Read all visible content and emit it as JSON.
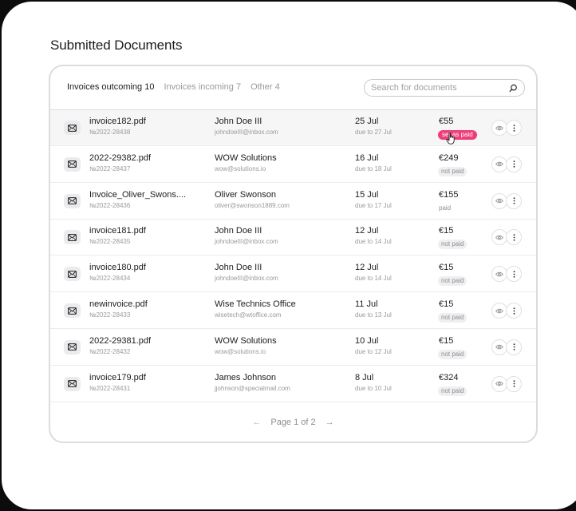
{
  "page_title": "Submitted Documents",
  "tabs": [
    {
      "label": "Invoices outcoming 10",
      "active": true
    },
    {
      "label": "Invoices incoming 7",
      "active": false
    },
    {
      "label": "Other 4",
      "active": false
    }
  ],
  "search": {
    "placeholder": "Search for documents"
  },
  "rows": [
    {
      "file": "invoice182.pdf",
      "number": "№2022-28438",
      "client": "John Doe III",
      "email": "johndoeIII@inbox.com",
      "date": "25 Jul",
      "due": "due to 27 Jul",
      "amount": "€55",
      "status": "set as paid"
    },
    {
      "file": "2022-29382.pdf",
      "number": "№2022-28437",
      "client": "WOW Solutions",
      "email": "wow@solutions.io",
      "date": "16 Jul",
      "due": "due to 18 Jul",
      "amount": "€249",
      "status": "not paid"
    },
    {
      "file": "Invoice_Oliver_Swons....",
      "number": "№2022-28436",
      "client": "Oliver Swonson",
      "email": "oliver@swonson1889.com",
      "date": "15 Jul",
      "due": "due to 17 Jul",
      "amount": "€155",
      "status": "paid"
    },
    {
      "file": "invoice181.pdf",
      "number": "№2022-28435",
      "client": "John Doe III",
      "email": "johndoeIII@inbox.com",
      "date": "12 Jul",
      "due": "due to 14 Jul",
      "amount": "€15",
      "status": "not paid"
    },
    {
      "file": "invoice180.pdf",
      "number": "№2022-28434",
      "client": "John Doe III",
      "email": "johndoeIII@inbox.com",
      "date": "12 Jul",
      "due": "due to 14 Jul",
      "amount": "€15",
      "status": "not paid"
    },
    {
      "file": "newinvoice.pdf",
      "number": "№2022-28433",
      "client": "Wise Technics Office",
      "email": "wisetech@wtoffice.com",
      "date": "11 Jul",
      "due": "due to 13 Jul",
      "amount": "€15",
      "status": "not paid"
    },
    {
      "file": "2022-29381.pdf",
      "number": "№2022-28432",
      "client": "WOW Solutions",
      "email": "wow@solutions.io",
      "date": "10 Jul",
      "due": "due to 12 Jul",
      "amount": "€15",
      "status": "not paid"
    },
    {
      "file": "invoice179.pdf",
      "number": "№2022-28431",
      "client": "James Johnson",
      "email": "jjohnson@specialmail.com",
      "date": "8 Jul",
      "due": "due to 10 Jul",
      "amount": "€324",
      "status": "not paid"
    }
  ],
  "pagination": {
    "label": "Page 1 of 2",
    "prev": "←",
    "next": "→"
  },
  "icons": {
    "row": "mail-icon",
    "view": "eye-icon",
    "more": "more-vertical-icon",
    "search": "search-icon",
    "cursor": "hand-pointer-icon"
  },
  "colors": {
    "accent": "#ef3d7a",
    "border": "#dcdcdc",
    "muted": "#9a9a9e"
  }
}
